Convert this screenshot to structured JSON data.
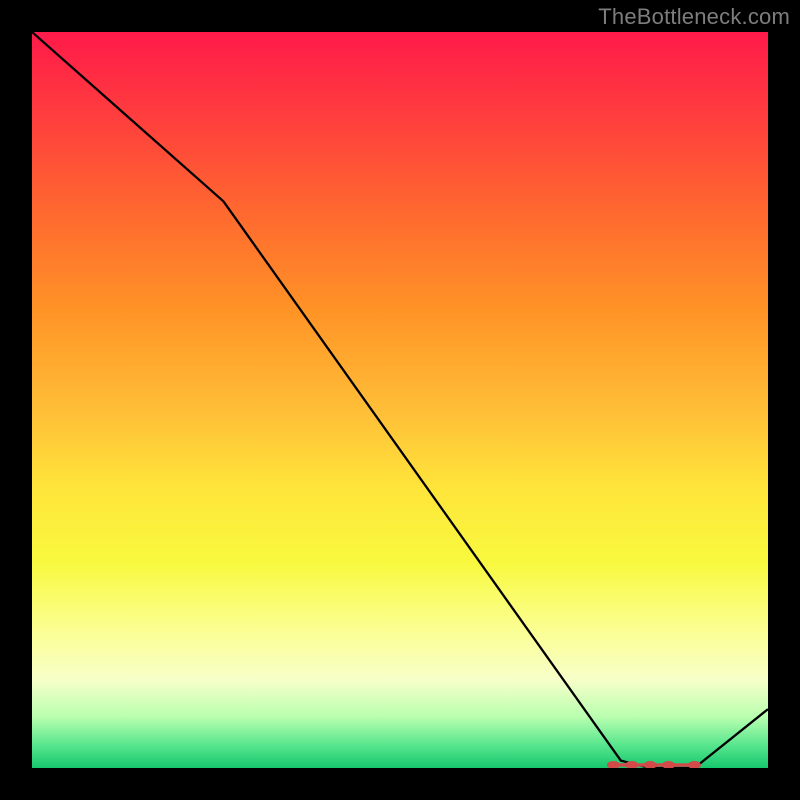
{
  "attribution": "TheBottleneck.com",
  "chart_data": {
    "type": "line",
    "title": "",
    "xlabel": "",
    "ylabel": "",
    "xlim": [
      0,
      100
    ],
    "ylim": [
      0,
      100
    ],
    "x": [
      0,
      26,
      80,
      84,
      90,
      100
    ],
    "values": [
      100,
      77,
      1,
      0,
      0,
      8
    ],
    "marker_segment": {
      "x_start": 79,
      "x_end": 90,
      "y": 0
    },
    "grid": false,
    "background": "heat-gradient"
  }
}
